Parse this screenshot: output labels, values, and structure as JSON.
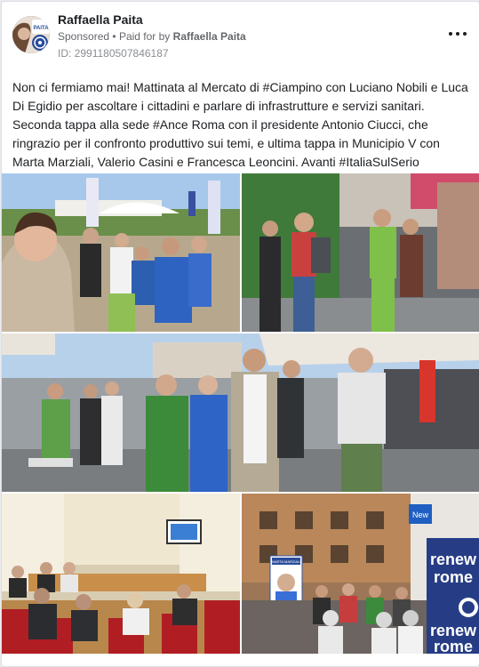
{
  "post": {
    "author": "Raffaella Paita",
    "sponsored_label": "Sponsored",
    "separator": "•",
    "paid_prefix": "Paid for by",
    "paid_by": "Raffaella Paita",
    "ad_id": "ID: 2991180507846187",
    "body": "Non ci fermiamo mai! Mattinata al Mercato di #Ciampino con Luciano Nobili e Luca Di Egidio per ascoltare i cittadini e parlare di infrastrutture e servizi sanitari. Seconda tappa alla sede #Ance Roma con il presidente Antonio Ciucci, che ringrazio per il confronto produttivo sui temi, e ultima tappa in Municipio V con Marta Marziali, Valerio Casini e Francesca Leoncini. Avanti #ItaliaSulSerio"
  },
  "avatar": {
    "text": "PAITA"
  },
  "photos": {
    "banner_text_1": "renew",
    "banner_text_2": "rome",
    "banner_text_3": "renew",
    "banner_text_4": "rome",
    "poster_text": "MARTA MARZIALI",
    "shop_sign": "New"
  },
  "colors": {
    "text_primary": "#1c1e21",
    "text_secondary": "#65676b",
    "brand_blue": "#2a4d9b"
  }
}
